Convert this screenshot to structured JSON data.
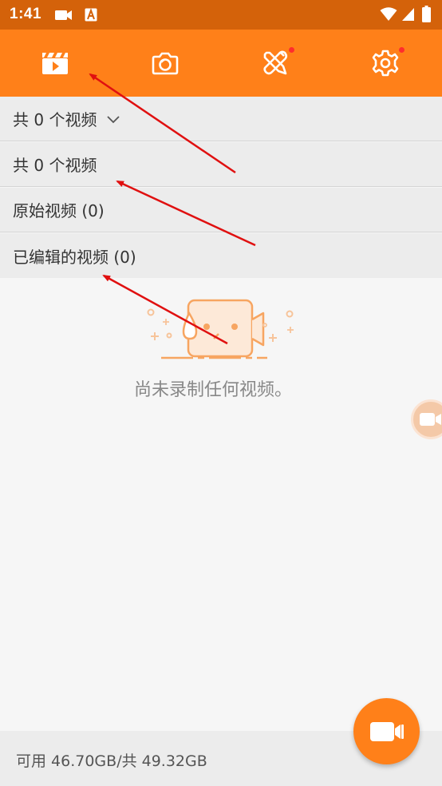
{
  "status_bar": {
    "time": "1:41",
    "icons": [
      "video-camera-icon",
      "font-a-icon",
      "wifi-icon",
      "signal-icon",
      "battery-icon"
    ]
  },
  "toolbar": {
    "tabs": [
      {
        "name": "videos",
        "icon": "clapperboard-play-icon",
        "active": true,
        "badge": false
      },
      {
        "name": "screenshots",
        "icon": "camera-icon",
        "active": false,
        "badge": false
      },
      {
        "name": "tools",
        "icon": "tools-icon",
        "active": false,
        "badge": true
      },
      {
        "name": "settings",
        "icon": "gear-icon",
        "active": false,
        "badge": true
      }
    ]
  },
  "filter_rows": {
    "dropdown_label": "共 0 个视频",
    "all_label": "共 0 个视频",
    "original_label": "原始视频 (0)",
    "edited_label": "已编辑的视频 (0)"
  },
  "empty_state": {
    "message": "尚未录制任何视频。",
    "icon": "sad-video-camera-icon"
  },
  "footer": {
    "storage": "可用 46.70GB/共 49.32GB"
  },
  "colors": {
    "primary": "#ff8019",
    "status_bar": "#d4620a",
    "badge": "#ff2d2d",
    "annotation_arrow": "#e01010",
    "illustration": "#f7a561"
  }
}
